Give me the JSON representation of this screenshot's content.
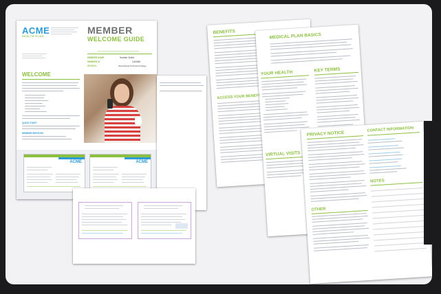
{
  "brand": {
    "logo": "ACME",
    "logo_sub": "HEALTH PLAN",
    "green": "#8bbf3f",
    "blue": "#2e9bd6",
    "gray_text": "#6f7072"
  },
  "welcome_guide": {
    "title_line1": "MEMBER",
    "title_line2": "WELCOME GUIDE",
    "member_name_label": "MEMBER NAME",
    "member_name_value": "Heather Zeifert",
    "member_id_label": "MEMBER ID",
    "member_id_value": "Cat3456",
    "school_label": "SCHOOL",
    "school_value": "Wonderland Technical College",
    "welcome_heading": "WELCOME",
    "quick_start": "QUICK START",
    "member_services": "MEMBER SERVICES"
  },
  "benefits_page": {
    "benefits_heading": "BENEFITS",
    "medical_heading": "MEDICAL PLAN BASICS",
    "your_health_heading": "YOUR HEALTH",
    "access_heading": "ACCESS YOUR BENEFITS",
    "virtual_heading": "VIRTUAL VISITS",
    "key_terms_heading": "KEY TERMS"
  },
  "privacy_page": {
    "privacy_heading": "PRIVACY NOTICE",
    "contact_heading": "CONTACT INFORMATION",
    "notes_heading": "NOTES",
    "other_heading": "OTHER"
  },
  "icons": {
    "photo": "woman-with-phone-photo",
    "logo": "acme-logo"
  }
}
